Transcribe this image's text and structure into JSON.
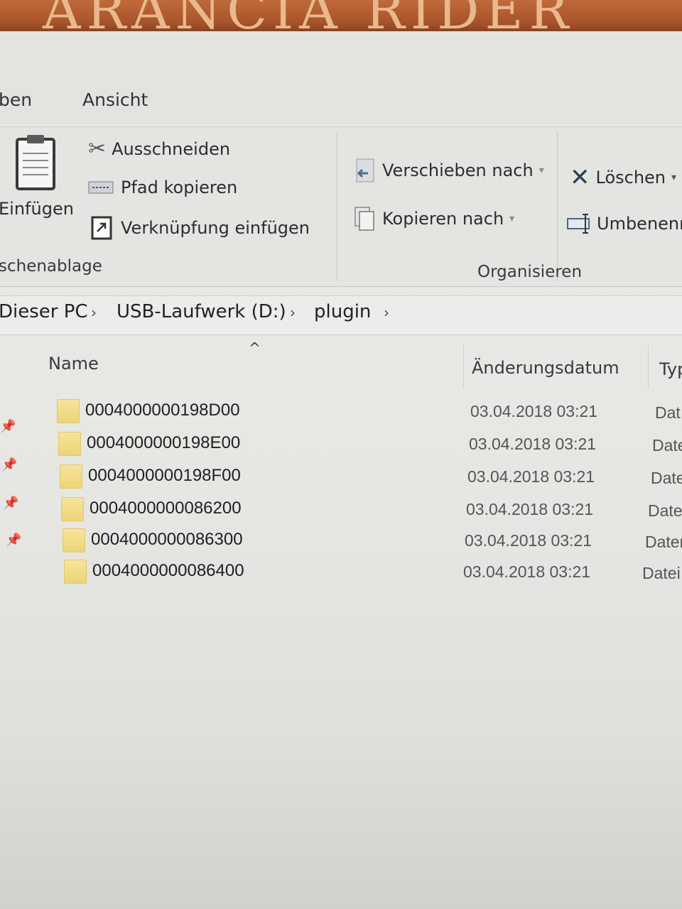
{
  "banner": {
    "text": "ARANCIA RIDER"
  },
  "tabs": [
    {
      "label": "ben"
    },
    {
      "label": "Ansicht"
    }
  ],
  "ribbon": {
    "clipboard": {
      "paste_label": "Einfügen",
      "cut_label": "Ausschneiden",
      "copy_path_label": "Pfad kopieren",
      "paste_shortcut_label": "Verknüpfung einfügen",
      "group_label": "schenablage"
    },
    "organize": {
      "move_to_label": "Verschieben nach",
      "copy_to_label": "Kopieren nach",
      "delete_label": "Löschen",
      "rename_label": "Umbenenn",
      "group_label": "Organisieren"
    }
  },
  "breadcrumb": [
    {
      "label": "Dieser PC"
    },
    {
      "label": "USB-Laufwerk (D:)"
    },
    {
      "label": "plugin"
    }
  ],
  "columns": {
    "name": "Name",
    "date": "Änderungsdatum",
    "type": "Typ"
  },
  "files": [
    {
      "name": "0004000000198D00",
      "date": "03.04.2018 03:21",
      "type": "Dat"
    },
    {
      "name": "0004000000198E00",
      "date": "03.04.2018 03:21",
      "type": "Date"
    },
    {
      "name": "0004000000198F00",
      "date": "03.04.2018 03:21",
      "type": "Date"
    },
    {
      "name": "0004000000086200",
      "date": "03.04.2018 03:21",
      "type": "Date"
    },
    {
      "name": "0004000000086300",
      "date": "03.04.2018 03:21",
      "type": "Dater"
    },
    {
      "name": "0004000000086400",
      "date": "03.04.2018 03:21",
      "type": "Datei"
    }
  ],
  "icons": {
    "folder": "folder-icon",
    "pin": "pin-icon"
  }
}
